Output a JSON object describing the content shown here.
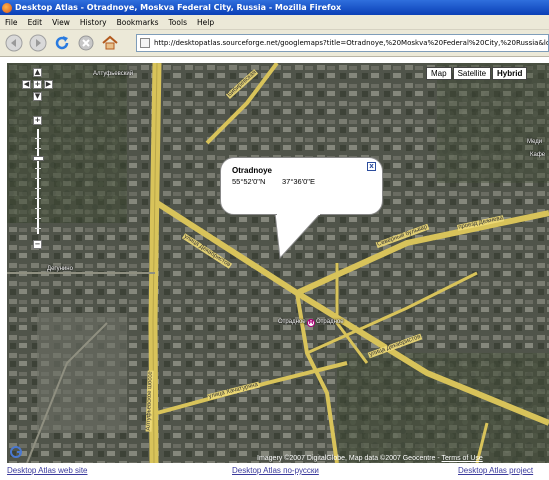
{
  "window": {
    "title": "Desktop Atlas - Otradnoye, Moskva Federal City, Russia - Mozilla Firefox"
  },
  "menu": [
    "File",
    "Edit",
    "View",
    "History",
    "Bookmarks",
    "Tools",
    "Help"
  ],
  "toolbar": {
    "icons": [
      "back-arrow-icon",
      "forward-arrow-icon",
      "reload-icon",
      "stop-icon",
      "home-icon"
    ],
    "url": "http://desktopatlas.sourceforge.net/googlemaps?title=Otradnoye,%20Moskva%20Federal%20City,%20Russia&loc=Otradnoye"
  },
  "map": {
    "type_buttons": [
      "Map",
      "Satellite",
      "Hybrid"
    ],
    "active_type": "Hybrid",
    "zoom_in": "+",
    "zoom_out": "−",
    "pan_up": "▲",
    "pan_down": "▼",
    "pan_left": "◀",
    "pan_right": "▶",
    "pan_center": "+",
    "infowindow": {
      "title": "Otradnoye",
      "lat": "55°52'0\"N",
      "lon": "37°36'0\"E",
      "close": "x"
    },
    "labels": {
      "altufyevsky": "Алтуфьевский",
      "dachnoye": "Дегунино",
      "otradnoe_station": "Отрадное",
      "otradnoe_metro": "Отрадное",
      "med": "Меди",
      "cafe": "Кафе"
    },
    "road_labels": {
      "bibirevskaya": "Бибиревская",
      "ul_dekabristov": "улица Декабристов",
      "severny_bulvar": "Северный бульвар",
      "proezd_dezhneva": "проезд Дежнева",
      "ul_khachaturyana": "улица Хачатуряна",
      "altufyevskoe_sh": "Алтуфьевское шоссе",
      "ul_dekabristov_2": "улица Декабристов"
    },
    "copyright": "Imagery ©2007 DigitalGlobe, Map data ©2007 Geocentre -",
    "terms": "Terms of Use",
    "colors": {
      "road": "#d8c35a",
      "satellite_base": "#4b4f44"
    }
  },
  "footer": {
    "left": "Desktop Atlas web site",
    "center": "Desktop Atlas по-русски",
    "right": "Desktop Atlas project"
  }
}
